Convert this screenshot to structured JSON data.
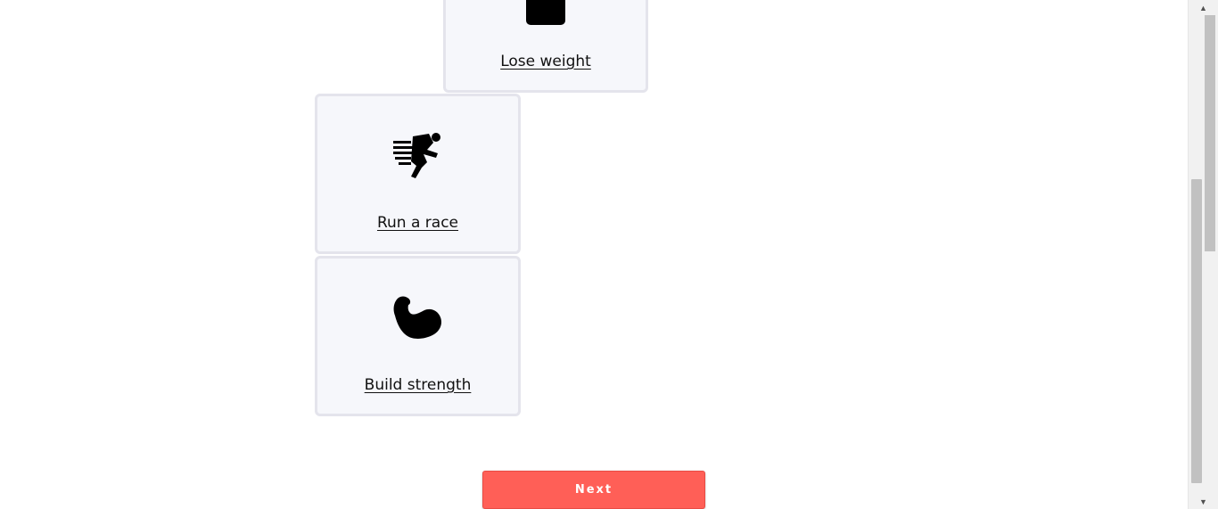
{
  "goals": [
    {
      "label": "Lose weight",
      "icon": "scale-icon"
    },
    {
      "label": "Run a race",
      "icon": "runner-icon"
    },
    {
      "label": "Build strength",
      "icon": "flexed-bicep-icon"
    }
  ],
  "next_button": {
    "label": "Next"
  },
  "colors": {
    "card_background": "#f6f7fb",
    "card_border": "#e4e4ec",
    "accent": "#ff5f57"
  }
}
